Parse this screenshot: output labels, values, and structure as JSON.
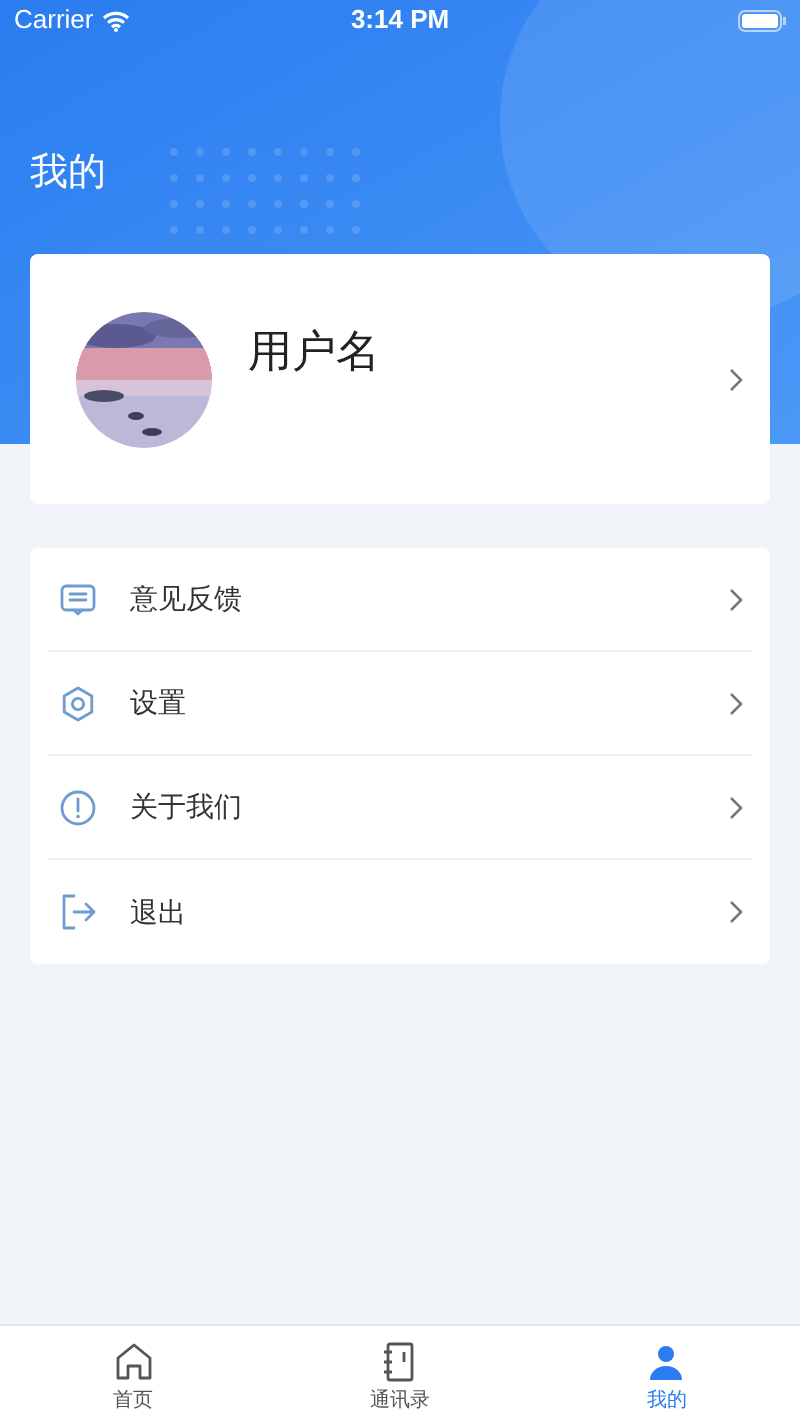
{
  "status_bar": {
    "carrier": "Carrier",
    "time": "3:14 PM"
  },
  "page_title": "我的",
  "profile": {
    "username": "用户名"
  },
  "menu": [
    {
      "kind": "feedback",
      "label": "意见反馈"
    },
    {
      "kind": "settings",
      "label": "设置"
    },
    {
      "kind": "about",
      "label": "关于我们"
    },
    {
      "kind": "logout",
      "label": "退出"
    }
  ],
  "tabs": [
    {
      "kind": "home",
      "label": "首页",
      "selected": false
    },
    {
      "kind": "contacts",
      "label": "通讯录",
      "selected": false
    },
    {
      "kind": "me",
      "label": "我的",
      "selected": true
    }
  ]
}
